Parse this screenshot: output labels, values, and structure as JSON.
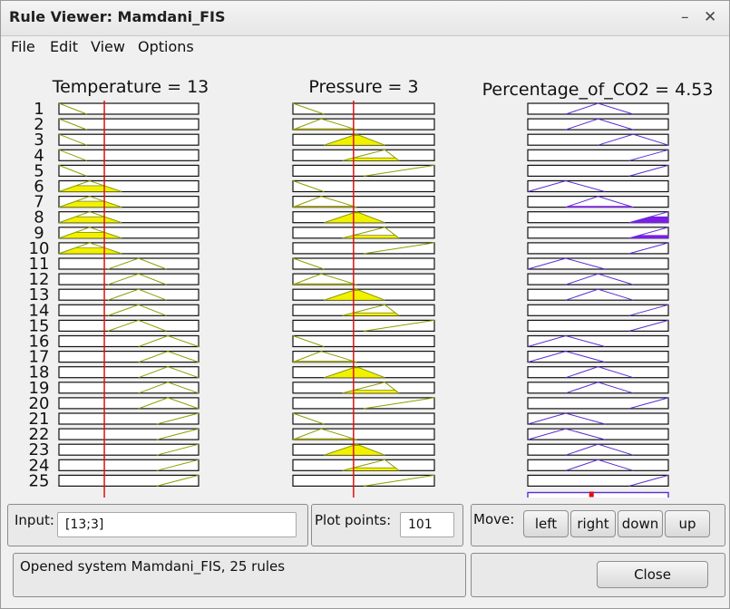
{
  "window": {
    "title": "Rule Viewer: Mamdani_FIS",
    "minimize_glyph": "–",
    "close_glyph": "✕"
  },
  "menu": [
    "File",
    "Edit",
    "View",
    "Options"
  ],
  "rule_viewer": {
    "inputs": [
      {
        "header": "Temperature = 13",
        "value": 13,
        "range": [
          0,
          40
        ]
      },
      {
        "header": "Pressure = 3",
        "value": 3,
        "range": [
          0,
          7
        ]
      }
    ],
    "output": {
      "header": "Percentage_of_CO2 = 4.53",
      "value": 4.53,
      "range": [
        0,
        10
      ]
    },
    "rule_numbers": [
      "1",
      "2",
      "3",
      "4",
      "5",
      "6",
      "7",
      "8",
      "9",
      "10",
      "11",
      "12",
      "13",
      "14",
      "15",
      "16",
      "17",
      "18",
      "19",
      "20",
      "21",
      "22",
      "23",
      "24",
      "25"
    ],
    "input_membership_function_per_rule": [
      [
        "low",
        "low"
      ],
      [
        "low",
        "medium"
      ],
      [
        "low",
        "high"
      ],
      [
        "low",
        "very_high"
      ],
      [
        "low",
        "extreme"
      ],
      [
        "medium",
        "low"
      ],
      [
        "medium",
        "medium"
      ],
      [
        "medium",
        "high"
      ],
      [
        "medium",
        "very_high"
      ],
      [
        "medium",
        "extreme"
      ],
      [
        "high",
        "low"
      ],
      [
        "high",
        "medium"
      ],
      [
        "high",
        "high"
      ],
      [
        "high",
        "very_high"
      ],
      [
        "high",
        "extreme"
      ],
      [
        "very_high",
        "low"
      ],
      [
        "very_high",
        "medium"
      ],
      [
        "very_high",
        "high"
      ],
      [
        "very_high",
        "very_high"
      ],
      [
        "very_high",
        "extreme"
      ],
      [
        "extreme",
        "low"
      ],
      [
        "extreme",
        "medium"
      ],
      [
        "extreme",
        "high"
      ],
      [
        "extreme",
        "very_high"
      ],
      [
        "extreme",
        "extreme"
      ]
    ],
    "output_membership_function_per_rule": [
      "mid",
      "mid",
      "mid-high",
      "high",
      "high",
      "low",
      "mid",
      "high",
      "high",
      "high",
      "low",
      "mid",
      "mid",
      "high",
      "high",
      "low",
      "low",
      "mid",
      "mid",
      "high",
      "low",
      "low",
      "mid",
      "mid",
      "high"
    ],
    "colors": {
      "input_fill": "#f2f200",
      "input_line": "#8aa000",
      "output_fill": "#7a1ee6",
      "output_line": "#5a2bd6",
      "value_line": "#e01010"
    }
  },
  "input": {
    "label": "Input:",
    "value": "[13;3]"
  },
  "plot_points": {
    "label": "Plot points:",
    "value": "101"
  },
  "move": {
    "label": "Move:",
    "buttons": [
      "left",
      "right",
      "down",
      "up"
    ]
  },
  "status_text": "Opened system Mamdani_FIS, 25 rules",
  "close_label": "Close"
}
